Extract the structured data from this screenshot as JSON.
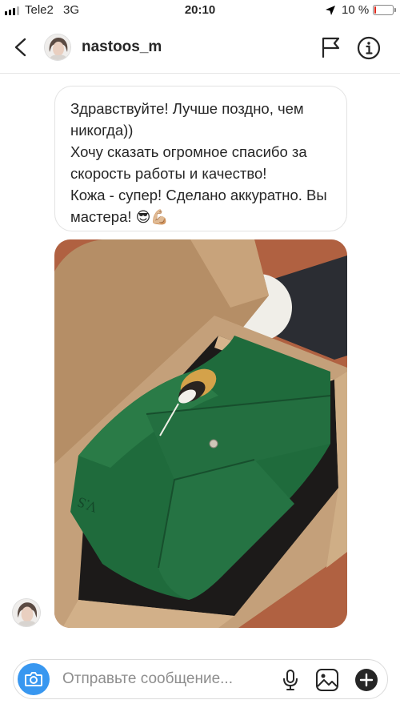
{
  "status_bar": {
    "carrier": "Tele2",
    "network": "3G",
    "time": "20:10",
    "battery_percent": "10 %",
    "battery_level": 0.1,
    "battery_color": "#e0271a"
  },
  "header": {
    "username": "nastoos_m",
    "icons": [
      "chevron-left-icon",
      "avatar",
      "flag-icon",
      "info-icon"
    ]
  },
  "conversation": {
    "message_lines": [
      "Здравствуйте! Лучше поздно, чем никогда))",
      "Хочу сказать огромное спасибо за скорость работы и качество!",
      "Кожа - супер! Сделано аккуратно. Вы мастера!"
    ],
    "message_emoji": "😎💪🏼",
    "photo_item_text": "V.S"
  },
  "composer": {
    "placeholder": "Отправьте сообщение...",
    "icons": [
      "camera-icon",
      "microphone-icon",
      "gallery-icon",
      "plus-icon"
    ]
  },
  "colors": {
    "accent": "#3897f0",
    "leather": "#1f6b3c",
    "box": "#c9a77c"
  }
}
